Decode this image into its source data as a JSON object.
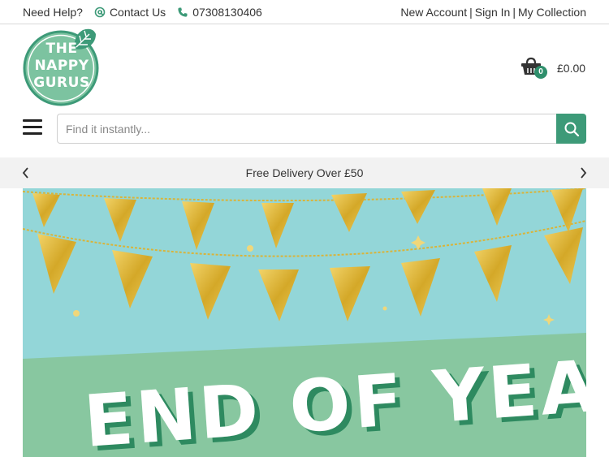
{
  "topbar": {
    "help_label": "Need Help?",
    "contact_label": "Contact Us",
    "phone": "07308130406",
    "new_account": "New Account",
    "sign_in": "Sign In",
    "my_collection": "My Collection",
    "separator": "|"
  },
  "logo": {
    "line1": "THE",
    "line2": "NAPPY",
    "line3": "GURUS"
  },
  "cart": {
    "count": "0",
    "total": "£0.00"
  },
  "search": {
    "placeholder": "Find it instantly..."
  },
  "promo": {
    "message": "Free Delivery Over £50"
  },
  "banner": {
    "headline": "END OF YEAR"
  },
  "colors": {
    "brand_green": "#3d9a78",
    "logo_green": "#7cc3a0",
    "banner_sky": "#93d6d8",
    "banner_band": "#88c7a0",
    "bunting_gold": "#d9b43a"
  },
  "icons": [
    "at-icon",
    "phone-icon",
    "basket-icon",
    "hamburger-icon",
    "search-icon",
    "chevron-left-icon",
    "chevron-right-icon",
    "leaf-icon"
  ]
}
